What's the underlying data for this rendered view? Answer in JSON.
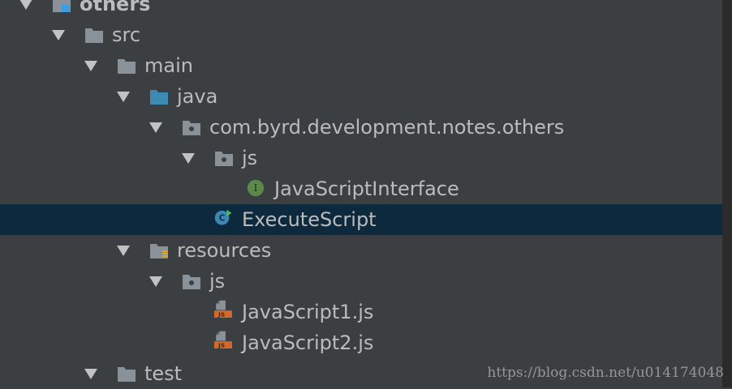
{
  "tree": {
    "items": [
      {
        "label": "others",
        "icon": "module-folder-icon"
      },
      {
        "label": "src",
        "icon": "folder-icon"
      },
      {
        "label": "main",
        "icon": "folder-icon"
      },
      {
        "label": "java",
        "icon": "source-folder-icon"
      },
      {
        "label": "com.byrd.development.notes.others",
        "icon": "package-icon"
      },
      {
        "label": "js",
        "icon": "package-icon"
      },
      {
        "label": "JavaScriptInterface",
        "icon": "interface-icon"
      },
      {
        "label": "ExecuteScript",
        "icon": "class-runnable-icon"
      },
      {
        "label": "resources",
        "icon": "resources-folder-icon"
      },
      {
        "label": "js",
        "icon": "package-icon"
      },
      {
        "label": "JavaScript1.js",
        "icon": "js-file-icon"
      },
      {
        "label": "JavaScript2.js",
        "icon": "js-file-icon"
      },
      {
        "label": "test",
        "icon": "folder-icon"
      }
    ]
  },
  "glyphs": {
    "interface": "I",
    "class": "C",
    "js_badge": "JS"
  },
  "watermark": "https://blog.csdn.net/u014174048",
  "colors": {
    "background": "#3c3f41",
    "selection": "#0d293e",
    "text": "#bbbbbb",
    "folder": "#8a9299",
    "source_folder": "#3d8ab3",
    "interface_badge": "#5b8a4a",
    "class_badge": "#3a86b5",
    "js_badge": "#d2692a"
  }
}
